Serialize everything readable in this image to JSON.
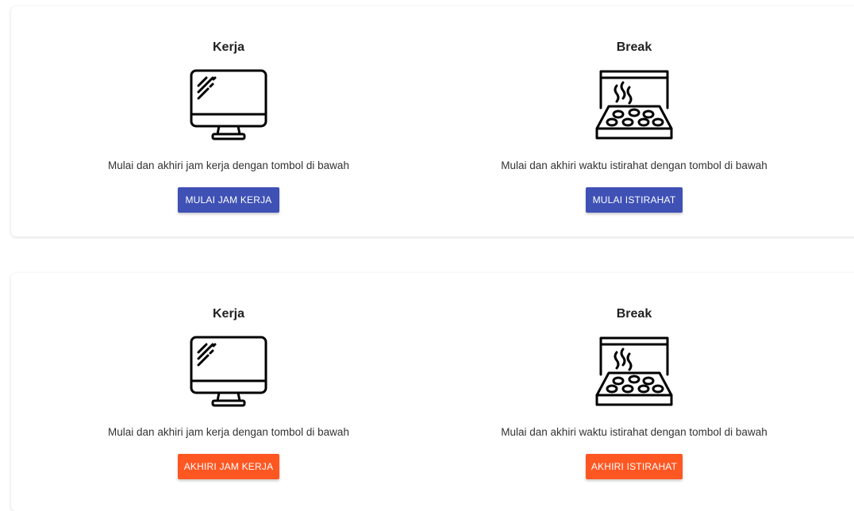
{
  "colors": {
    "start_button": "#3f51b5",
    "end_button": "#ff5722",
    "title_text": "#212121",
    "body_text": "#333333"
  },
  "cards": [
    {
      "work": {
        "title": "Kerja",
        "icon": "monitor-icon",
        "description": "Mulai dan akhiri jam kerja dengan tombol di bawah",
        "button_label": "MULAI JAM KERJA"
      },
      "break": {
        "title": "Break",
        "icon": "pizza-box-icon",
        "description": "Mulai dan akhiri waktu istirahat dengan tombol di bawah",
        "button_label": "MULAI ISTIRAHAT"
      }
    },
    {
      "work": {
        "title": "Kerja",
        "icon": "monitor-icon",
        "description": "Mulai dan akhiri jam kerja dengan tombol di bawah",
        "button_label": "AKHIRI JAM KERJA"
      },
      "break": {
        "title": "Break",
        "icon": "pizza-box-icon",
        "description": "Mulai dan akhiri waktu istirahat dengan tombol di bawah",
        "button_label": "AKHIRI ISTIRAHAT"
      }
    }
  ]
}
